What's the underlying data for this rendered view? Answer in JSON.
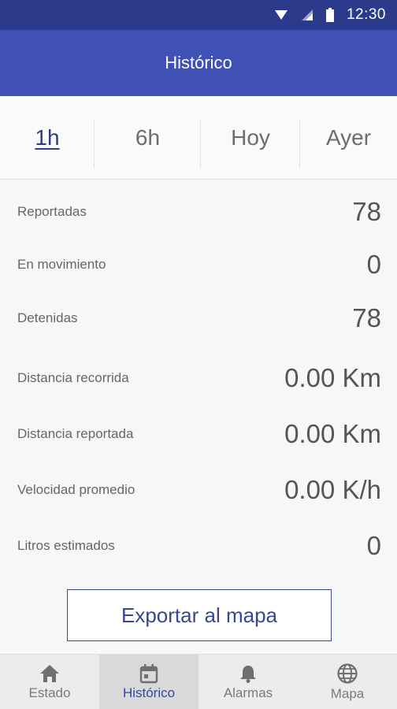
{
  "status_bar": {
    "time": "12:30"
  },
  "header": {
    "title": "Histórico"
  },
  "tabs": [
    {
      "label": "1h"
    },
    {
      "label": "6h"
    },
    {
      "label": "Hoy"
    },
    {
      "label": "Ayer"
    }
  ],
  "active_tab": "1h",
  "stats": [
    {
      "label": "Reportadas",
      "value": "78"
    },
    {
      "label": "En movimiento",
      "value": "0"
    },
    {
      "label": "Detenidas",
      "value": "78"
    },
    {
      "label": "Distancia recorrida",
      "value": "0.00 Km"
    },
    {
      "label": "Distancia reportada",
      "value": "0.00 Km"
    },
    {
      "label": "Velocidad promedio",
      "value": "0.00 K/h"
    },
    {
      "label": "Litros estimados",
      "value": "0"
    }
  ],
  "export_label": "Exportar al mapa",
  "bottom_nav": [
    {
      "label": "Estado",
      "icon": "home-icon"
    },
    {
      "label": "Histórico",
      "icon": "calendar-icon"
    },
    {
      "label": "Alarmas",
      "icon": "bell-icon"
    },
    {
      "label": "Mapa",
      "icon": "globe-icon"
    }
  ],
  "active_nav": "Histórico",
  "colors": {
    "status_bar": "#2c3a8c",
    "app_bar": "#3f51b5",
    "accent": "#3a4790",
    "background": "#f7f7f7"
  }
}
